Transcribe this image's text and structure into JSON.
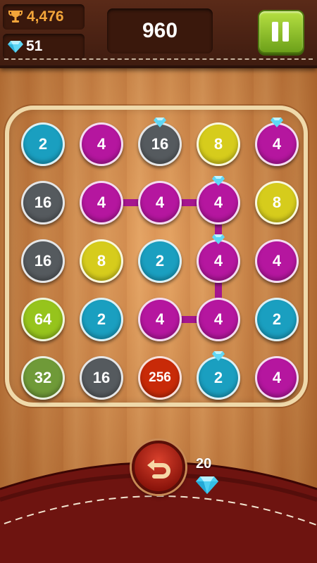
{
  "hud": {
    "best_score": "4,476",
    "gems": "51",
    "score": "960"
  },
  "board": {
    "rows": [
      [
        {
          "v": "2",
          "c": "blue"
        },
        {
          "v": "4",
          "c": "magenta"
        },
        {
          "v": "16",
          "c": "gray",
          "gem": true
        },
        {
          "v": "8",
          "c": "yellow"
        },
        {
          "v": "4",
          "c": "magenta",
          "gem": true
        }
      ],
      [
        {
          "v": "16",
          "c": "gray"
        },
        {
          "v": "4",
          "c": "magenta"
        },
        {
          "v": "4",
          "c": "magenta"
        },
        {
          "v": "4",
          "c": "magenta",
          "gem": true
        },
        {
          "v": "8",
          "c": "yellow"
        }
      ],
      [
        {
          "v": "16",
          "c": "gray"
        },
        {
          "v": "8",
          "c": "yellow"
        },
        {
          "v": "2",
          "c": "blue"
        },
        {
          "v": "4",
          "c": "magenta",
          "gem": true
        },
        {
          "v": "4",
          "c": "magenta"
        }
      ],
      [
        {
          "v": "64",
          "c": "lime"
        },
        {
          "v": "2",
          "c": "blue"
        },
        {
          "v": "4",
          "c": "magenta"
        },
        {
          "v": "4",
          "c": "magenta"
        },
        {
          "v": "2",
          "c": "blue"
        }
      ],
      [
        {
          "v": "32",
          "c": "olive"
        },
        {
          "v": "16",
          "c": "gray"
        },
        {
          "v": "256",
          "c": "red"
        },
        {
          "v": "2",
          "c": "blue",
          "gem": true
        },
        {
          "v": "4",
          "c": "magenta"
        }
      ]
    ],
    "chain": [
      [
        1,
        1
      ],
      [
        1,
        2
      ],
      [
        1,
        3
      ],
      [
        2,
        3
      ],
      [
        3,
        3
      ],
      [
        3,
        2
      ]
    ],
    "colors": {
      "blue": "#1a9fc0",
      "magenta": "#b5169f",
      "gray": "#555a5e",
      "yellow": "#d6cc1c",
      "lime": "#96c41c",
      "olive": "#6f9a38",
      "red": "#c82a08",
      "chain": "#a5158f"
    }
  },
  "undo": {
    "cost": "20"
  }
}
